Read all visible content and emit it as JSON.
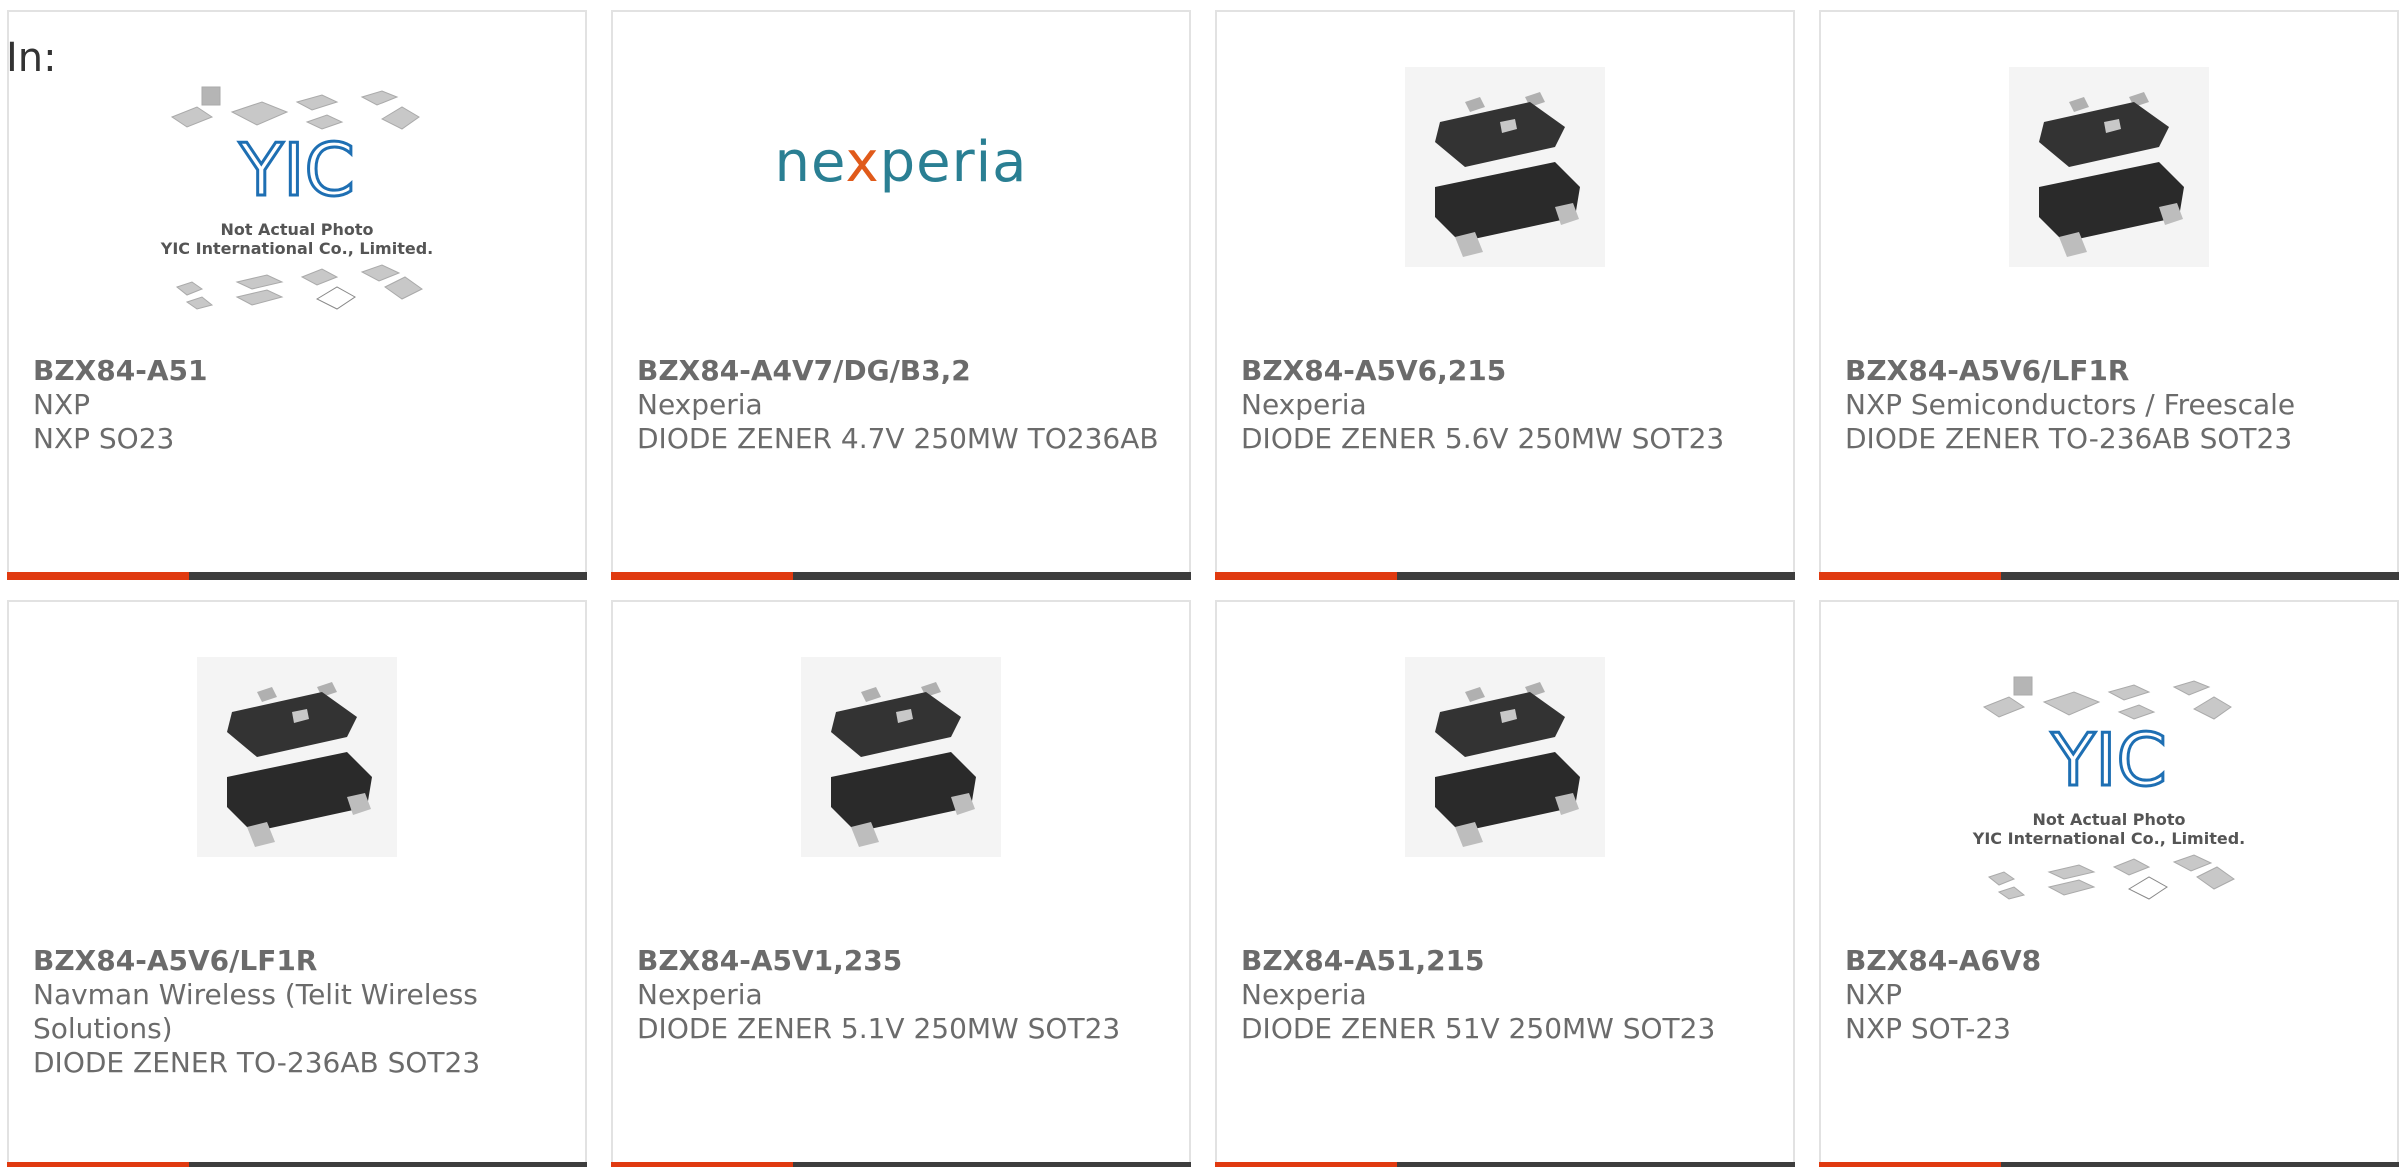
{
  "header": {
    "in_label": "In:"
  },
  "placeholder": {
    "line1": "Not Actual Photo",
    "line2": "YIC International Co., Limited.",
    "logo": "YIC"
  },
  "brand_logo": {
    "pre": "ne",
    "x": "x",
    "post": "peria"
  },
  "cards": [
    {
      "part": "BZX84-A51",
      "mfr": "NXP",
      "desc": "NXP SO23",
      "image": "placeholder"
    },
    {
      "part": "BZX84-A4V7/DG/B3,2",
      "mfr": "Nexperia",
      "desc": "DIODE ZENER 4.7V 250MW TO236AB",
      "image": "nexperia-logo"
    },
    {
      "part": "BZX84-A5V6,215",
      "mfr": "Nexperia",
      "desc": "DIODE ZENER 5.6V 250MW SOT23",
      "image": "sot23"
    },
    {
      "part": "BZX84-A5V6/LF1R",
      "mfr": "NXP Semiconductors / Freescale",
      "desc": "DIODE ZENER TO-236AB SOT23",
      "image": "sot23"
    },
    {
      "part": "BZX84-A5V6/LF1R",
      "mfr": "Navman Wireless (Telit Wireless Solutions)",
      "desc": "DIODE ZENER TO-236AB SOT23",
      "image": "sot23"
    },
    {
      "part": "BZX84-A5V1,235",
      "mfr": "Nexperia",
      "desc": "DIODE ZENER 5.1V 250MW SOT23",
      "image": "sot23"
    },
    {
      "part": "BZX84-A51,215",
      "mfr": "Nexperia",
      "desc": "DIODE ZENER 51V 250MW SOT23",
      "image": "sot23"
    },
    {
      "part": "BZX84-A6V8",
      "mfr": "NXP",
      "desc": "NXP SOT-23",
      "image": "placeholder"
    }
  ],
  "colors": {
    "accent": "#e03a10",
    "bar": "#3d3d3d",
    "text": "#6b6b6b",
    "brand_teal": "#2a7f93"
  }
}
